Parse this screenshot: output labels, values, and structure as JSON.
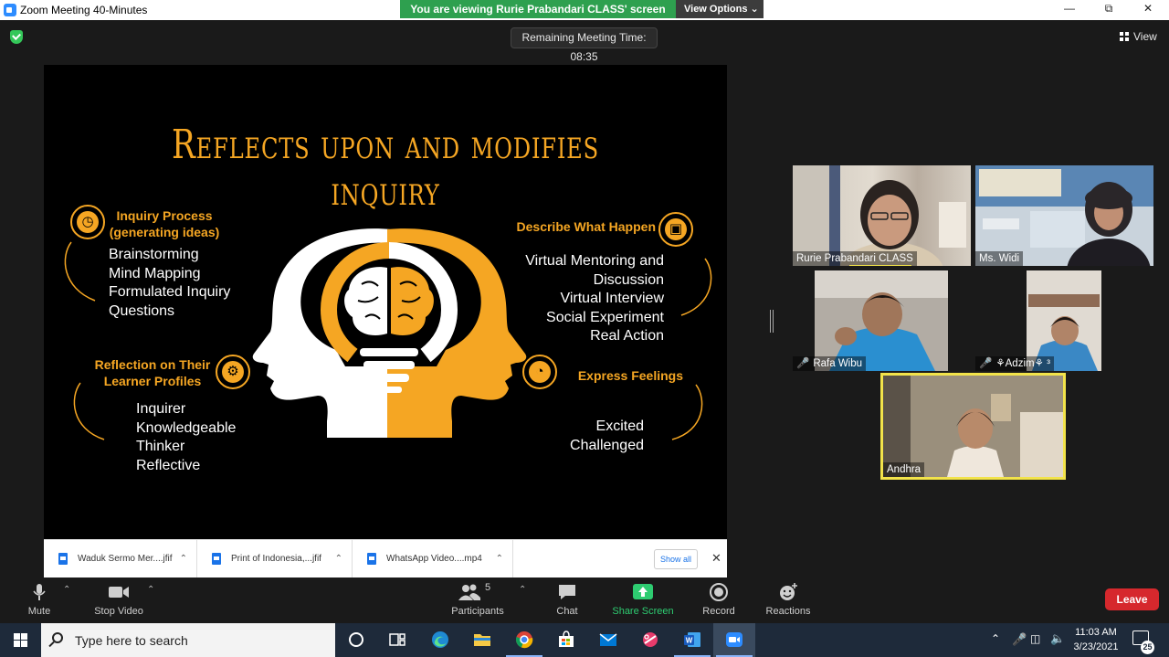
{
  "window": {
    "title": "Zoom Meeting 40-Minutes",
    "viewing_banner": "You are viewing Rurie Prabandari CLASS' screen",
    "view_options": "View Options"
  },
  "meeting": {
    "remaining_time": "Remaining Meeting Time: 08:35",
    "view_label": "View"
  },
  "slide": {
    "title": "Reflects upon and modifies inquiry",
    "inquiry_process": {
      "heading": [
        "Inquiry Process",
        "(generating ideas)"
      ],
      "items": [
        "Brainstorming",
        "Mind Mapping",
        "Formulated Inquiry",
        "Questions"
      ]
    },
    "reflection": {
      "heading": [
        "Reflection on Their",
        "Learner Profiles"
      ],
      "items": [
        "Inquirer",
        "Knowledgeable",
        "Thinker",
        "Reflective"
      ]
    },
    "describe": {
      "heading": "Describe What Happen",
      "items": [
        "Virtual Mentoring and",
        "Discussion",
        "Virtual Interview",
        "Social Experiment",
        "Real Action"
      ]
    },
    "express": {
      "heading": "Express Feelings",
      "items": [
        "Excited",
        "Challenged"
      ]
    }
  },
  "downloads": {
    "items": [
      {
        "name": "Waduk Sermo Mer....jfif"
      },
      {
        "name": "Print of Indonesia,...jfif"
      },
      {
        "name": "WhatsApp Video....mp4"
      }
    ],
    "show_all": "Show all"
  },
  "participants_video": [
    {
      "name": "Rurie Prabandari CLASS",
      "muted": false,
      "speaking": true
    },
    {
      "name": "Ms. Widi",
      "muted": false
    },
    {
      "name": "Rafa Wibu",
      "muted": true
    },
    {
      "name": "⚘Adzim⚘ ³",
      "muted": true
    },
    {
      "name": "Andhra",
      "muted": false,
      "active": true
    }
  ],
  "toolbar": {
    "mute": "Mute",
    "stop_video": "Stop Video",
    "participants_count": "5",
    "participants": "Participants",
    "chat": "Chat",
    "share_screen": "Share Screen",
    "record": "Record",
    "reactions": "Reactions",
    "leave": "Leave"
  },
  "taskbar": {
    "search_placeholder": "Type here to search",
    "time": "11:03 AM",
    "date": "3/23/2021",
    "notification_count": "25",
    "apps": [
      "task-view",
      "edge",
      "file-explorer",
      "chrome",
      "store",
      "mail",
      "snip",
      "word",
      "zoom"
    ]
  },
  "colors": {
    "accent": "#f5a623",
    "zoom_blue": "#2d8cff",
    "green": "#2ea04f",
    "leave_red": "#d6282d"
  }
}
